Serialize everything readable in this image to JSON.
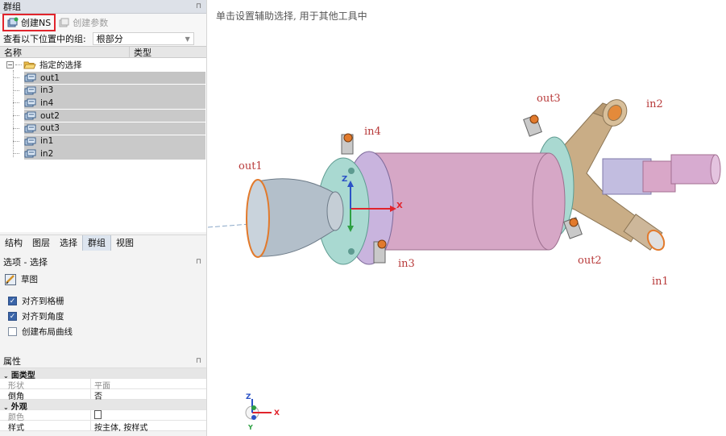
{
  "group_panel": {
    "title": "群组",
    "toolbar": {
      "create_ns": "创建NS",
      "create_param": "创建参数"
    },
    "view_groups_label": "查看以下位置中的组:",
    "view_groups_value": "根部分",
    "columns": {
      "name": "名称",
      "type": "类型"
    },
    "tree": {
      "root": "指定的选择",
      "items": [
        "out1",
        "in3",
        "in4",
        "out2",
        "out3",
        "in1",
        "in2"
      ]
    }
  },
  "tabs": [
    "结构",
    "图层",
    "选择",
    "群组",
    "视图"
  ],
  "options_panel": {
    "title": "选项 - 选择",
    "sketch": "草图",
    "checkboxes": [
      {
        "label": "对齐到格栅",
        "checked": true
      },
      {
        "label": "对齐到角度",
        "checked": true
      },
      {
        "label": "创建布局曲线",
        "checked": false
      }
    ]
  },
  "properties_panel": {
    "title": "属性",
    "sections": [
      {
        "name": "面类型",
        "rows": [
          {
            "key": "形状",
            "value": "平面"
          },
          {
            "key": "倒角",
            "value": "否"
          }
        ]
      },
      {
        "name": "外观",
        "rows": [
          {
            "key": "颜色",
            "value": ""
          },
          {
            "key": "样式",
            "value": "按主体, 按样式"
          }
        ]
      }
    ]
  },
  "viewport": {
    "hint": "单击设置辅助选择, 用于其他工具中",
    "labels": {
      "out1": "out1",
      "in4": "in4",
      "in3": "in3",
      "out3": "out3",
      "in2": "in2",
      "out2": "out2",
      "in1": "in1"
    },
    "axis": {
      "x": "X",
      "y": "Y",
      "z": "Z"
    },
    "colors": {
      "highlight": "#e1242c",
      "label": "#b83a3a",
      "pipe": "#d6a7c6",
      "flange": "#c9b4de",
      "teal": "#a9d9d1",
      "brass": "#c9ad86",
      "nozzle": "#b3bfca",
      "edge": "#e27a2c"
    }
  }
}
